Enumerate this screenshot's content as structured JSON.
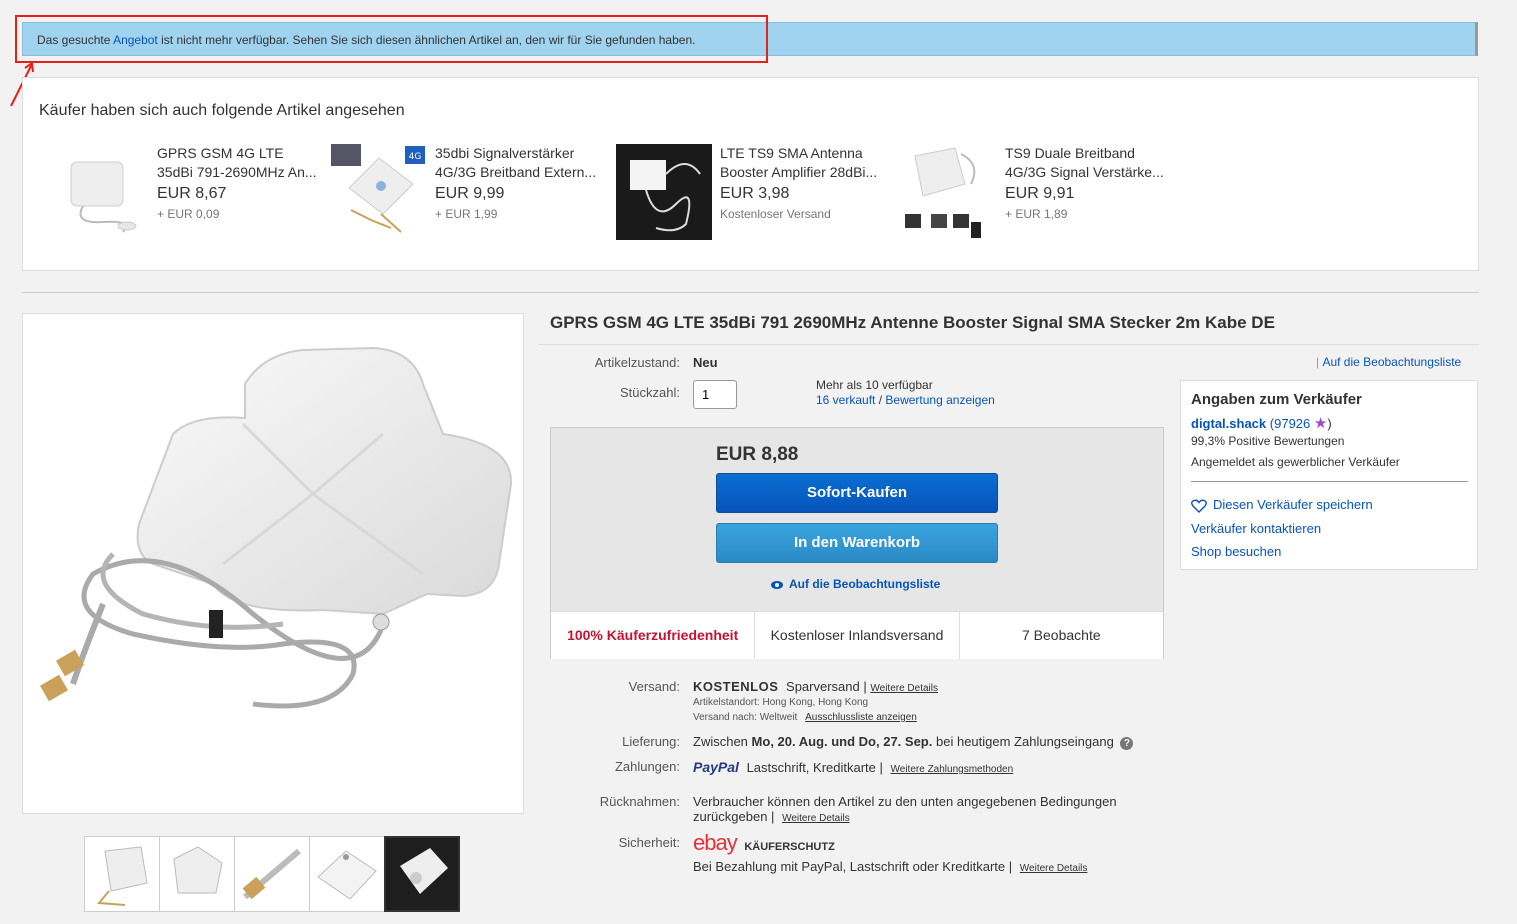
{
  "notice": {
    "prefix": "Das gesuchte",
    "link": "Angebot",
    "suffix": "ist nicht mehr verfügbar. Sehen Sie sich diesen ähnlichen Artikel an, den wir für Sie gefunden haben."
  },
  "similar": {
    "title": "Käufer haben sich auch folgende Artikel angesehen",
    "items": [
      {
        "line1": "GPRS GSM 4G LTE",
        "line2": "35dBi 791-2690MHz An...",
        "price": "EUR 8,67",
        "shipping": "+ EUR 0,09"
      },
      {
        "line1": "35dbi Signalverstärker",
        "line2": "4G/3G Breitband Extern...",
        "price": "EUR 9,99",
        "shipping": "+ EUR 1,99"
      },
      {
        "line1": "LTE TS9 SMA Antenna",
        "line2": "Booster Amplifier 28dBi...",
        "price": "EUR 3,98",
        "shipping": "Kostenloser Versand"
      },
      {
        "line1": "TS9 Duale Breitband",
        "line2": "4G/3G Signal Verstärke...",
        "price": "EUR 9,91",
        "shipping": "+ EUR 1,89"
      }
    ]
  },
  "item": {
    "title": "GPRS GSM 4G LTE 35dBi 791 2690MHz Antenne Booster Signal SMA Stecker 2m Kabe DE",
    "condition_label": "Artikelzustand:",
    "condition": "Neu",
    "watchlist_link": "Auf die Beobachtungsliste",
    "qty_label": "Stückzahl:",
    "qty_value": "1",
    "available": "Mehr als 10 verfügbar",
    "sold": "16 verkauft",
    "rating_link": "Bewertung anzeigen"
  },
  "buybox": {
    "price": "EUR 8,88",
    "buy_now": "Sofort-Kaufen",
    "add_cart": "In den Warenkorb",
    "watch": "Auf die Beobachtungsliste",
    "stat1": "100% Käuferzufriedenheit",
    "stat2": "Kostenloser Inlandsversand",
    "stat3": "7 Beobachte"
  },
  "seller": {
    "title": "Angaben zum Verkäufer",
    "name": "digtal.shack",
    "score": "97926",
    "positive": "99,3% Positive Bewertungen",
    "type": "Angemeldet als gewerblicher Verkäufer",
    "save": "Diesen Verkäufer speichern",
    "contact": "Verkäufer kontaktieren",
    "shop": "Shop besuchen"
  },
  "details": {
    "shipping_label": "Versand:",
    "shipping_free": "KOSTENLOS",
    "shipping_type": "Sparversand",
    "more_details": "Weitere Details",
    "location": "Artikelstandort:  Hong Kong, Hong Kong",
    "ships_to": "Versand nach:  Weltweit",
    "exclusions": "Ausschlussliste anzeigen",
    "delivery_label": "Lieferung:",
    "delivery_prefix": "Zwischen",
    "delivery_dates": "Mo, 20. Aug. und Do, 27. Sep.",
    "delivery_suffix": "bei heutigem Zahlungseingang",
    "payment_label": "Zahlungen:",
    "paypal": "PayPal",
    "payment_methods": "Lastschrift,  Kreditkarte  |",
    "more_payment": "Weitere Zahlungsmethoden",
    "returns_label": "Rücknahmen:",
    "returns_text": "Verbraucher können den Artikel zu den unten angegebenen Bedingungen zurückgeben |",
    "security_label": "Sicherheit:",
    "ebay": "ebay",
    "buyer_protection": "KÄUFERSCHUTZ",
    "security_text": "Bei Bezahlung mit PayPal, Lastschrift oder Kreditkarte |"
  }
}
